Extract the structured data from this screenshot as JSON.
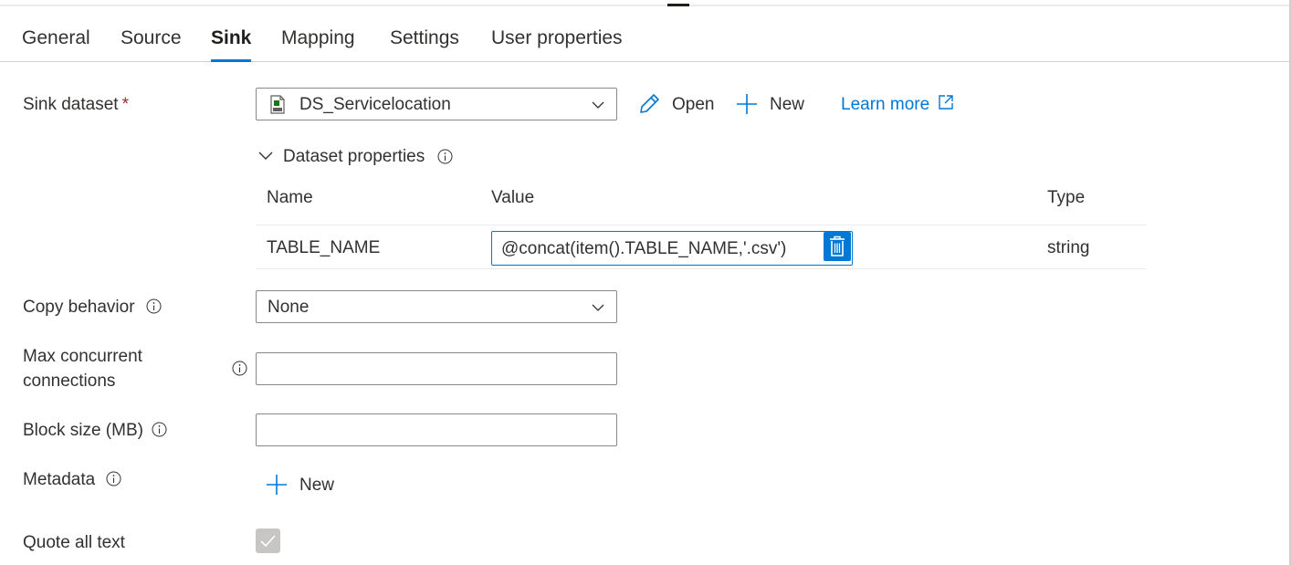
{
  "tabs": [
    {
      "label": "General"
    },
    {
      "label": "Source"
    },
    {
      "label": "Sink"
    },
    {
      "label": "Mapping"
    },
    {
      "label": "Settings"
    },
    {
      "label": "User properties"
    }
  ],
  "active_tab": "Sink",
  "sink_dataset": {
    "label": "Sink dataset",
    "required_mark": "*",
    "value": "DS_Servicelocation",
    "file_icon": "csv-file-icon",
    "open_label": "Open",
    "new_label": "New",
    "learn_more_label": "Learn more"
  },
  "dataset_properties": {
    "label": "Dataset properties",
    "expanded": true,
    "columns": {
      "name": "Name",
      "value": "Value",
      "type": "Type"
    },
    "rows": [
      {
        "name": "TABLE_NAME",
        "value": "@concat(item().TABLE_NAME,'.csv')",
        "type": "string"
      }
    ]
  },
  "copy_behavior": {
    "label": "Copy behavior",
    "value": "None"
  },
  "max_concurrent": {
    "label_line1": "Max concurrent",
    "label_line2": "connections",
    "value": ""
  },
  "block_size": {
    "label": "Block size (MB)",
    "value": ""
  },
  "metadata": {
    "label": "Metadata",
    "new_label": "New"
  },
  "quote_all_text": {
    "label": "Quote all text",
    "checked": true,
    "disabled": true
  },
  "colors": {
    "accent": "#0078d4",
    "required": "#a4262c",
    "text": "#323130",
    "checkbox_disabled": "#c8c6c4"
  }
}
